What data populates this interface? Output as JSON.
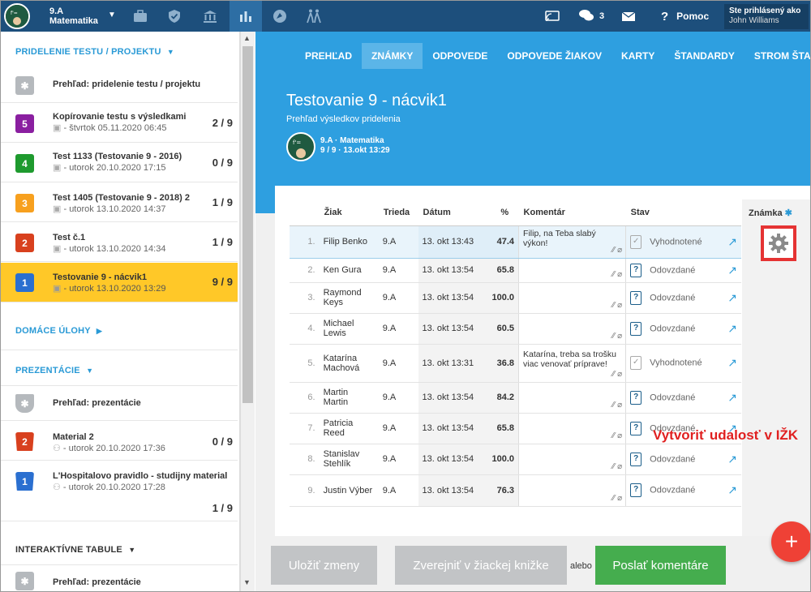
{
  "topbar": {
    "class_name": "9.A",
    "subject": "Matematika",
    "messages_count": "3",
    "help_label": "Pomoc",
    "user_label": "Ste prihlásený ako",
    "user_name": "John Williams"
  },
  "sidebar": {
    "section_tests": "PRIDELENIE TESTU / PROJEKTU",
    "section_homework": "DOMÁCE ÚLOHY",
    "section_presentations": "PREZENTÁCIE",
    "section_boards": "INTERAKTÍVNE TABULE",
    "tests_overview": "Prehľad: pridelenie testu / projektu",
    "tests": [
      {
        "badge": "5",
        "color": "#8a1fa0",
        "title": "Kopírovanie testu s výsledkami",
        "date": "štvrtok 05.11.2020 06:45",
        "count": "2 / 9"
      },
      {
        "badge": "4",
        "color": "#1e9a2e",
        "title": "Test 1133 (Testovanie 9 - 2016)",
        "date": "utorok 20.10.2020 17:15",
        "count": "0 / 9"
      },
      {
        "badge": "3",
        "color": "#f7a01e",
        "title": "Test 1405 (Testovanie 9 - 2018) 2",
        "date": "utorok 13.10.2020 14:37",
        "count": "1 / 9"
      },
      {
        "badge": "2",
        "color": "#d8401e",
        "title": "Test č.1",
        "date": "utorok 13.10.2020 14:34",
        "count": "1 / 9"
      },
      {
        "badge": "1",
        "color": "#2a6fd0",
        "title": "Testovanie 9 - nácvik1",
        "date": "utorok 13.10.2020 13:29",
        "count": "9 / 9"
      }
    ],
    "presentations_overview": "Prehľad: prezentácie",
    "presentations": [
      {
        "badge": "2",
        "color": "#d8401e",
        "title": "Material 2",
        "date": "utorok 20.10.2020 17:36",
        "count": "0 / 9"
      },
      {
        "badge": "1",
        "color": "#2a6fd0",
        "title": "L'Hospitalovo pravidlo - studijny material",
        "date": "utorok 20.10.2020 17:28",
        "count": "1 / 9"
      }
    ],
    "boards_overview": "Prehľad: prezentácie"
  },
  "tabs": [
    "PREHĽAD",
    "ZNÁMKY",
    "ODPOVEDE",
    "ODPOVEDE ŽIAKOV",
    "KARTY",
    "ŠTANDARDY",
    "STROM ŠTANDARDOV"
  ],
  "hero": {
    "title": "Testovanie 9 - nácvik1",
    "subtitle": "Prehľad výsledkov pridelenia",
    "class_line": "9.A · Matematika",
    "info_line": "9 / 9 · 13.okt 13:29"
  },
  "table": {
    "headers": [
      "Žiak",
      "Trieda",
      "Dátum",
      "%",
      "Komentár",
      "Stav",
      "Známka"
    ],
    "rows": [
      {
        "n": "1.",
        "name": "Filip Benko",
        "cls": "9.A",
        "date": "13. okt 13:43",
        "pct": "47.4",
        "comment": "Filip, na Teba slabý výkon!",
        "status": "Vyhodnotené",
        "done": true
      },
      {
        "n": "2.",
        "name": "Ken Gura",
        "cls": "9.A",
        "date": "13. okt 13:54",
        "pct": "65.8",
        "comment": "",
        "status": "Odovzdané",
        "done": false
      },
      {
        "n": "3.",
        "name": "Raymond Keys",
        "cls": "9.A",
        "date": "13. okt 13:54",
        "pct": "100.0",
        "comment": "",
        "status": "Odovzdané",
        "done": false
      },
      {
        "n": "4.",
        "name": "Michael Lewis",
        "cls": "9.A",
        "date": "13. okt 13:54",
        "pct": "60.5",
        "comment": "",
        "status": "Odovzdané",
        "done": false
      },
      {
        "n": "5.",
        "name": "Katarína Machová",
        "cls": "9.A",
        "date": "13. okt 13:31",
        "pct": "36.8",
        "comment": "Katarína, treba sa trošku viac venovať príprave!",
        "status": "Vyhodnotené",
        "done": true
      },
      {
        "n": "6.",
        "name": "Martin Martin",
        "cls": "9.A",
        "date": "13. okt 13:54",
        "pct": "84.2",
        "comment": "",
        "status": "Odovzdané",
        "done": false
      },
      {
        "n": "7.",
        "name": "Patricia Reed",
        "cls": "9.A",
        "date": "13. okt 13:54",
        "pct": "65.8",
        "comment": "",
        "status": "Odovzdané",
        "done": false
      },
      {
        "n": "8.",
        "name": "Stanislav Stehlík",
        "cls": "9.A",
        "date": "13. okt 13:54",
        "pct": "100.0",
        "comment": "",
        "status": "Odovzdané",
        "done": false
      },
      {
        "n": "9.",
        "name": "Justin Výber",
        "cls": "9.A",
        "date": "13. okt 13:54",
        "pct": "76.3",
        "comment": "",
        "status": "Odovzdané",
        "done": false
      }
    ]
  },
  "annotation": "Vytvoriť udalosť v IŽK",
  "buttons": {
    "save": "Uložiť zmeny",
    "publish": "Zverejniť v žiackej knižke",
    "or": "alebo",
    "send": "Poslať komentáre"
  }
}
